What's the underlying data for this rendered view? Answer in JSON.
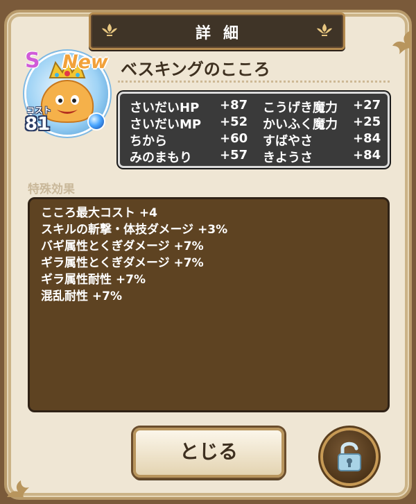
{
  "dialog": {
    "title": "詳細",
    "rank": "S",
    "new_badge": "New",
    "cost_label": "コスト",
    "cost_value": "81",
    "heart_name": "ベスキングのこころ",
    "stats": [
      {
        "label": "さいだいHP",
        "value": "+87",
        "label2": "こうげき魔力",
        "value2": "+27"
      },
      {
        "label": "さいだいMP",
        "value": "+52",
        "label2": "かいふく魔力",
        "value2": "+25"
      },
      {
        "label": "ちから",
        "value": "+60",
        "label2": "すばやさ",
        "value2": "+84"
      },
      {
        "label": "みのまもり",
        "value": "+57",
        "label2": "きようさ",
        "value2": "+84"
      }
    ],
    "special_label": "特殊効果",
    "effects": [
      "こころ最大コスト +4",
      "スキルの斬撃・体技ダメージ +3%",
      "バギ属性とくぎダメージ +7%",
      "ギラ属性とくぎダメージ +7%",
      "ギラ属性耐性 +7%",
      "混乱耐性 +7%"
    ],
    "close_label": "とじる"
  },
  "icons": {
    "title_ornament": "fleur-de-lis-icon",
    "portrait": "slime-king-portrait",
    "orb": "blue-orb-icon",
    "lock": "unlocked-padlock-icon"
  },
  "colors": {
    "panel_bg": "#efe6d4",
    "stats_bg": "#3a3a3a",
    "effects_bg": "#5e4322",
    "title_bg": "#3f3427",
    "new_badge": "#f2a13a",
    "rank_s": "#d05bd8"
  }
}
